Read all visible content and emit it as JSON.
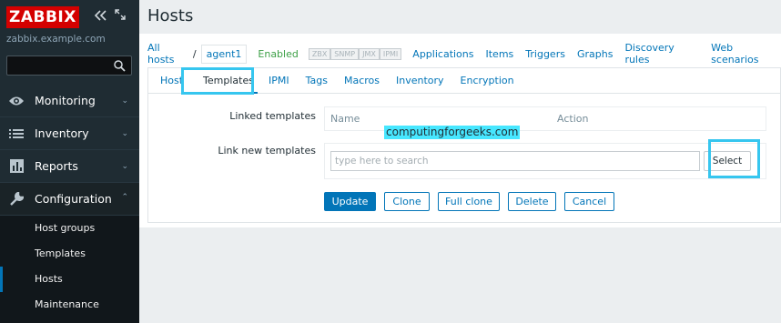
{
  "sidebar": {
    "logo": "ZABBIX",
    "server_name": "zabbix.example.com",
    "search_placeholder": "",
    "menu": [
      {
        "label": "Monitoring",
        "icon": "eye-icon"
      },
      {
        "label": "Inventory",
        "icon": "list-icon"
      },
      {
        "label": "Reports",
        "icon": "bar-chart-icon"
      },
      {
        "label": "Configuration",
        "icon": "wrench-icon"
      }
    ],
    "submenu": [
      {
        "label": "Host groups"
      },
      {
        "label": "Templates"
      },
      {
        "label": "Hosts"
      },
      {
        "label": "Maintenance"
      }
    ]
  },
  "page": {
    "title": "Hosts"
  },
  "breadcrumbs": {
    "all_hosts": "All hosts",
    "separator": "/",
    "current": "agent1",
    "status": "Enabled",
    "badges": [
      "ZBX",
      "SNMP",
      "JMX",
      "IPMI"
    ],
    "links": [
      "Applications",
      "Items",
      "Triggers",
      "Graphs",
      "Discovery rules",
      "Web scenarios"
    ]
  },
  "tabs": [
    "Host",
    "Templates",
    "IPMI",
    "Tags",
    "Macros",
    "Inventory",
    "Encryption"
  ],
  "form": {
    "linked_templates_label": "Linked templates",
    "col_name": "Name",
    "col_action": "Action",
    "link_new_label": "Link new templates",
    "search_placeholder": "type here to search",
    "select_label": "Select"
  },
  "buttons": {
    "update": "Update",
    "clone": "Clone",
    "full_clone": "Full clone",
    "delete": "Delete",
    "cancel": "Cancel"
  },
  "watermark": "computingforgeeks.com",
  "colors": {
    "sidebar_bg": "#1f2c33",
    "logo_red": "#d40000",
    "link_blue": "#0275b8",
    "enabled_green": "#3da047",
    "highlight_cyan": "#36c6ef"
  }
}
